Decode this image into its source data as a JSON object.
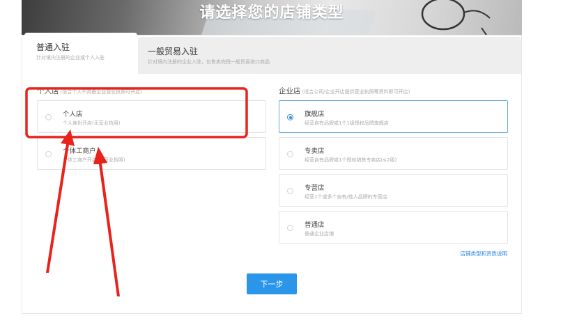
{
  "hero": {
    "title": "请选择您的店铺类型"
  },
  "tabs": [
    {
      "title": "普通入驻",
      "subtitle": "针对境内注册的企业或个人入驻"
    },
    {
      "title": "一般贸易入驻",
      "subtitle": "针对境内注册的企业入驻，仅售卖完税一般贸易进口商品"
    }
  ],
  "personal": {
    "heading": "个人店",
    "hint": "(适合个人不具备企业营业执照可开店)",
    "options": [
      {
        "title": "个人店",
        "desc": "个人身份开店(无营业执照)"
      },
      {
        "title": "个体工商户",
        "desc": "个体工商户开店(有营业执照)"
      }
    ]
  },
  "enterprise": {
    "heading": "企业店",
    "hint": "(适合公司/企业开店提供营业执照等资料即可开店)",
    "options": [
      {
        "title": "旗舰店",
        "desc": "经营自有品牌或1个1级授权品牌旗舰店",
        "selected": true
      },
      {
        "title": "专卖店",
        "desc": "经营自有品牌或1个授权销售专卖店(≤2级)"
      },
      {
        "title": "专营店",
        "desc": "经营1个或多个自有/他人品牌的专营店"
      },
      {
        "title": "普通店",
        "desc": "普通企业店铺"
      }
    ],
    "help_link": "店铺类型和资质说明"
  },
  "actions": {
    "next_label": "下一步"
  },
  "colors": {
    "accent": "#2b95e9",
    "annotation": "#e8231c"
  }
}
